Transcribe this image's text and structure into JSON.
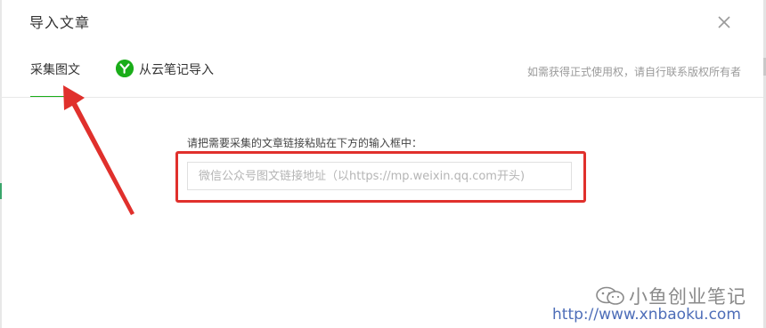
{
  "dialog": {
    "title": "导入文章",
    "close_icon": "close-icon"
  },
  "tabs": [
    {
      "label": "采集图文",
      "active": true
    },
    {
      "label": "从云笔记导入",
      "icon": "youdao-note-icon",
      "active": false
    }
  ],
  "copyright_note": "如需获得正式使用权，请自行联系版权所有者",
  "form": {
    "instruction": "请把需要采集的文章链接粘贴在下方的输入框中：",
    "url_placeholder": "微信公众号图文链接地址（以https://mp.weixin.qq.com开头)",
    "url_value": ""
  },
  "annotation": {
    "arrow_color": "#e0302c",
    "box_color": "#e0302c"
  },
  "watermark": {
    "icon": "wechat-icon",
    "name": "小鱼创业笔记",
    "url": "http://www.xnbaoku.com"
  },
  "colors": {
    "accent": "#1aad19"
  }
}
